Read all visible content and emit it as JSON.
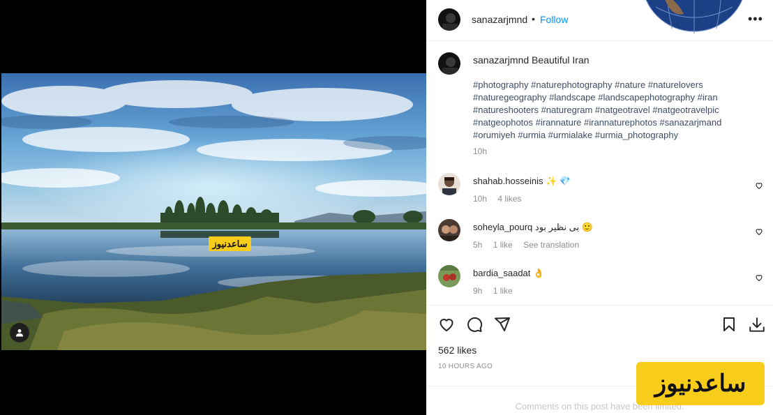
{
  "post": {
    "username": "sanazarjmnd",
    "separator": "•",
    "follow_label": "Follow",
    "more_label": "•••",
    "caption_text": "Beautiful Iran",
    "hashtags": "#photography #naturephotography #nature #naturelovers #naturegeography #landscape #landscapephotography #iran #natureshooters #naturegram #natgeotravel #natgeotravelpic #natgeophotos #irannature #irannaturephotos #sanazarjmand #orumiyeh #urmia #urmialake #urmia_photography",
    "caption_time": "10h",
    "likes": "562 likes",
    "posted_ago": "10 HOURS AGO",
    "comments_limited": "Comments on this post have been limited."
  },
  "comments": [
    {
      "username": "shahab.hosseinis",
      "text": "",
      "emoji": "✨ 💎",
      "time": "10h",
      "likes": "4 likes",
      "extra": ""
    },
    {
      "username": "soheyla_pourq",
      "text": "بی نظیر بود",
      "emoji": "🙂",
      "time": "5h",
      "likes": "1 like",
      "extra": "See translation"
    },
    {
      "username": "bardia_saadat",
      "text": "",
      "emoji": "👌",
      "time": "9h",
      "likes": "1 like",
      "extra": ""
    }
  ],
  "watermark": {
    "small": "ساعدنیوز",
    "large": "ساعدنیوز"
  },
  "colors": {
    "link": "#0095f6",
    "hashtag": "#3d4c64",
    "muted": "#8e8e8e",
    "watermark_bg": "#f7cc1b"
  },
  "icons": [
    "heart-icon",
    "comment-icon",
    "share-icon",
    "bookmark-icon",
    "download-icon",
    "user-tag-icon",
    "more-icon"
  ]
}
